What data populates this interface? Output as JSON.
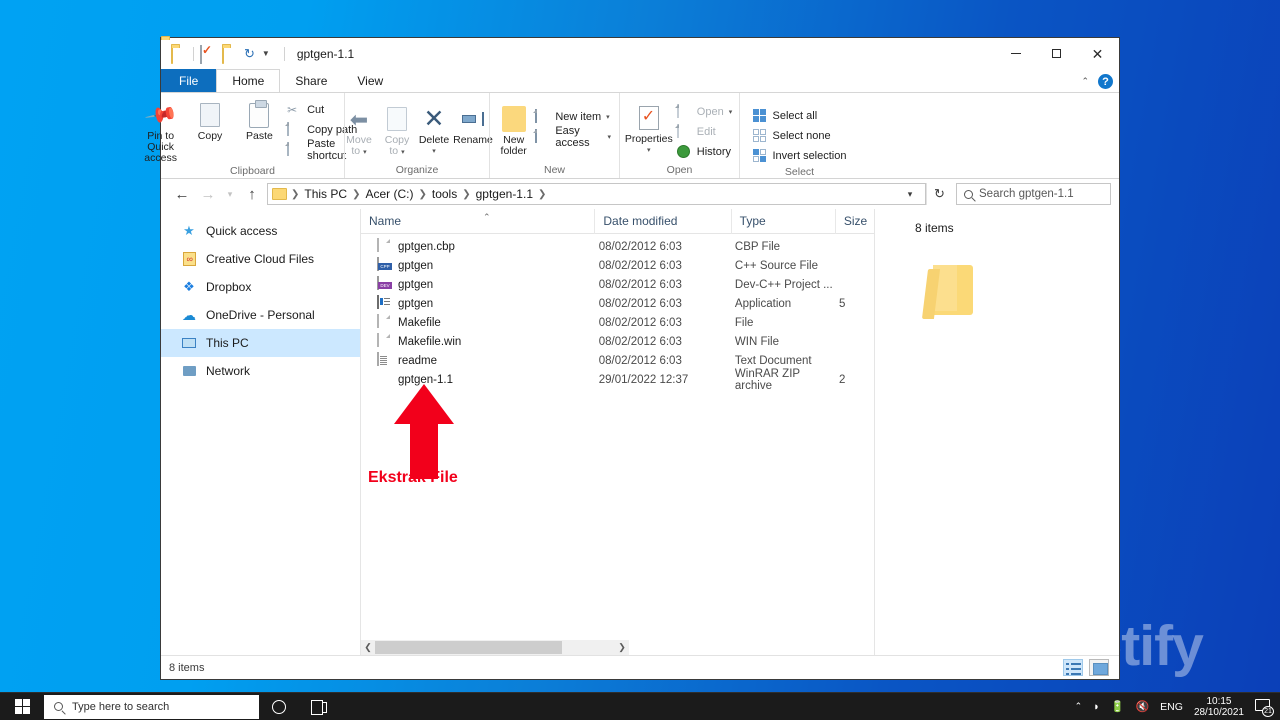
{
  "desktop": {
    "watermark": "uplotify"
  },
  "window": {
    "title": "gptgen-1.1",
    "quick_access_icons": [
      "folder-icon",
      "properties-icon",
      "new-folder-icon",
      "undo-icon",
      "customize-caret-icon"
    ],
    "controls": {
      "minimize": "minimize-icon",
      "maximize": "maximize-icon",
      "close": "close-icon"
    },
    "help_label": "?"
  },
  "ribbon": {
    "tabs": [
      {
        "label": "File",
        "active": false,
        "kind": "file"
      },
      {
        "label": "Home",
        "active": true,
        "kind": "normal"
      },
      {
        "label": "Share",
        "active": false,
        "kind": "normal"
      },
      {
        "label": "View",
        "active": false,
        "kind": "normal"
      }
    ],
    "groups": [
      {
        "label": "Clipboard",
        "big": [
          {
            "label": "Pin to Quick\naccess",
            "line1": "Pin to Quick",
            "line2": "access",
            "icon": "pin-icon"
          },
          {
            "label": "Copy",
            "line1": "Copy",
            "line2": "",
            "icon": "copy-icon"
          },
          {
            "label": "Paste",
            "line1": "Paste",
            "line2": "",
            "icon": "paste-icon"
          }
        ],
        "small": [
          {
            "label": "Cut",
            "icon": "scissors-icon",
            "dim": false
          },
          {
            "label": "Copy path",
            "icon": "copy-path-icon",
            "dim": false
          },
          {
            "label": "Paste shortcut",
            "icon": "paste-shortcut-icon",
            "dim": false
          }
        ]
      },
      {
        "label": "Organize",
        "big": [
          {
            "line1": "Move",
            "line2": "to",
            "icon": "move-to-icon",
            "caret": true,
            "dim": true
          },
          {
            "line1": "Copy",
            "line2": "to",
            "icon": "copy-to-icon",
            "caret": true,
            "dim": true
          },
          {
            "line1": "Delete",
            "line2": "",
            "icon": "delete-x-icon",
            "caret": true,
            "dim": false
          },
          {
            "line1": "Rename",
            "line2": "",
            "icon": "rename-icon",
            "caret": false,
            "dim": false
          }
        ],
        "small": []
      },
      {
        "label": "New",
        "big": [
          {
            "line1": "New",
            "line2": "folder",
            "icon": "new-folder-icon"
          }
        ],
        "small": [
          {
            "label": "New item",
            "icon": "new-item-icon",
            "caret": true,
            "dim": false
          },
          {
            "label": "Easy access",
            "icon": "easy-access-icon",
            "caret": true,
            "dim": false
          }
        ]
      },
      {
        "label": "Open",
        "big": [
          {
            "line1": "Properties",
            "line2": "",
            "icon": "properties-icon",
            "caret": true
          }
        ],
        "small": [
          {
            "label": "Open",
            "icon": "open-icon",
            "caret": true,
            "dim": true
          },
          {
            "label": "Edit",
            "icon": "edit-icon",
            "caret": false,
            "dim": true
          },
          {
            "label": "History",
            "icon": "history-icon",
            "caret": false,
            "dim": false
          }
        ]
      },
      {
        "label": "Select",
        "big": [],
        "small": [
          {
            "label": "Select all",
            "icon": "select-all-icon",
            "dim": false
          },
          {
            "label": "Select none",
            "icon": "select-none-icon",
            "dim": false
          },
          {
            "label": "Invert selection",
            "icon": "invert-selection-icon",
            "dim": false
          }
        ]
      }
    ]
  },
  "address_bar": {
    "back_icon": "back-arrow-icon",
    "forward_icon": "forward-arrow-icon",
    "recent_icon": "recent-locations-icon",
    "up_icon": "up-arrow-icon",
    "breadcrumbs": [
      "This PC",
      "Acer (C:)",
      "tools",
      "gptgen-1.1"
    ],
    "dropdown_icon": "chevron-down-icon",
    "refresh_icon": "refresh-icon",
    "search_placeholder": "Search gptgen-1.1"
  },
  "nav_pane": {
    "items": [
      {
        "label": "Quick access",
        "icon": "pin-star-icon",
        "selected": false
      },
      {
        "label": "Creative Cloud Files",
        "icon": "creative-cloud-icon",
        "selected": false
      },
      {
        "label": "Dropbox",
        "icon": "dropbox-icon",
        "selected": false
      },
      {
        "label": "OneDrive - Personal",
        "icon": "onedrive-cloud-icon",
        "selected": false
      },
      {
        "label": "This PC",
        "icon": "this-pc-icon",
        "selected": true
      },
      {
        "label": "Network",
        "icon": "network-icon",
        "selected": false
      }
    ]
  },
  "file_list": {
    "columns": [
      {
        "label": "Name",
        "sorted": true
      },
      {
        "label": "Date modified",
        "sorted": false
      },
      {
        "label": "Type",
        "sorted": false
      },
      {
        "label": "Size",
        "sorted": false
      }
    ],
    "rows": [
      {
        "name": "gptgen.cbp",
        "date": "08/02/2012 6:03",
        "type": "CBP File",
        "size": "",
        "icon": "blank-file-icon"
      },
      {
        "name": "gptgen",
        "date": "08/02/2012 6:03",
        "type": "C++ Source File",
        "size": "",
        "icon": "cpp-file-icon"
      },
      {
        "name": "gptgen",
        "date": "08/02/2012 6:03",
        "type": "Dev-C++ Project ...",
        "size": "",
        "icon": "dev-project-icon"
      },
      {
        "name": "gptgen",
        "date": "08/02/2012 6:03",
        "type": "Application",
        "size": "5",
        "icon": "application-icon"
      },
      {
        "name": "Makefile",
        "date": "08/02/2012 6:03",
        "type": "File",
        "size": "",
        "icon": "blank-file-icon"
      },
      {
        "name": "Makefile.win",
        "date": "08/02/2012 6:03",
        "type": "WIN File",
        "size": "",
        "icon": "blank-file-icon"
      },
      {
        "name": "readme",
        "date": "08/02/2012 6:03",
        "type": "Text Document",
        "size": "",
        "icon": "text-document-icon"
      },
      {
        "name": "gptgen-1.1",
        "date": "29/01/2022 12:37",
        "type": "WinRAR ZIP archive",
        "size": "2",
        "icon": "winrar-archive-icon"
      }
    ]
  },
  "annotation": {
    "text": "Ekstrak File",
    "color": "#f2001b",
    "arrow_icon": "red-up-arrow-icon"
  },
  "preview_pane": {
    "count_label": "8 items",
    "icon": "folder-large-icon"
  },
  "status_bar": {
    "item_count": "8 items",
    "view_details_icon": "details-view-icon",
    "view_large_icon": "large-icons-view-icon"
  },
  "taskbar": {
    "start_icon": "windows-start-icon",
    "search_placeholder": "Type here to search",
    "cortana_icon": "cortana-icon",
    "task_view_icon": "task-view-icon",
    "tray": {
      "chevron": "show-hidden-icons-icon",
      "wifi_icon": "wifi-icon",
      "battery_icon": "battery-icon",
      "volume_icon": "volume-muted-icon",
      "language": "ENG",
      "time": "10:15",
      "date": "28/10/2021",
      "notification_count": "21"
    }
  }
}
